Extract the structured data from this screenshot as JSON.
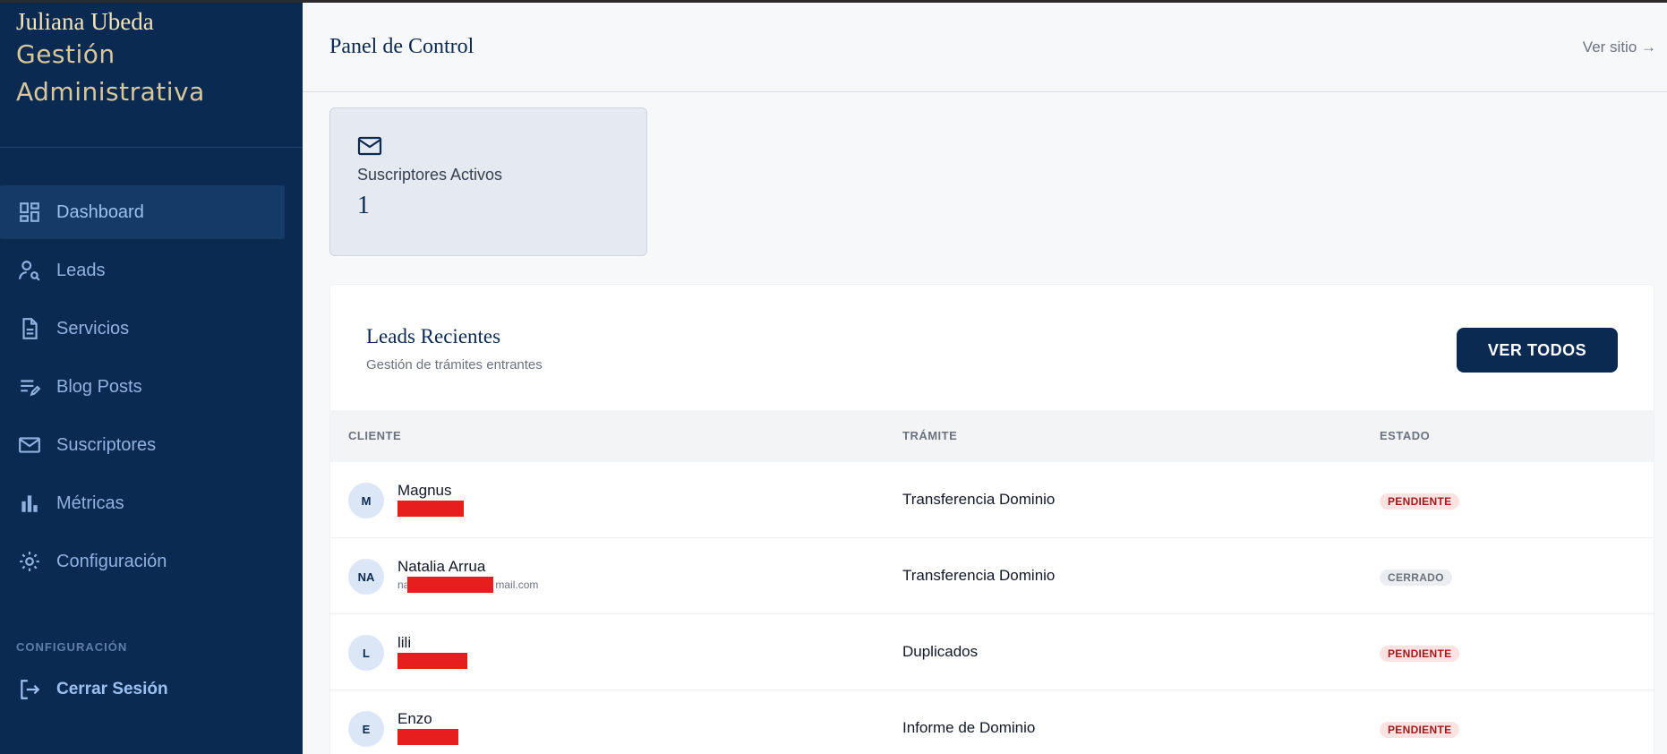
{
  "brand": {
    "name": "Juliana Ubeda",
    "subtitle_line1": "Gestión",
    "subtitle_line2": "Administrativa"
  },
  "sidebar": {
    "items": [
      {
        "label": "Dashboard",
        "icon": "dashboard-icon",
        "active": true
      },
      {
        "label": "Leads",
        "icon": "user-search-icon"
      },
      {
        "label": "Servicios",
        "icon": "document-icon"
      },
      {
        "label": "Blog Posts",
        "icon": "edit-list-icon"
      },
      {
        "label": "Suscriptores",
        "icon": "mail-icon"
      },
      {
        "label": "Métricas",
        "icon": "bar-chart-icon"
      },
      {
        "label": "Configuración",
        "icon": "gear-icon"
      }
    ],
    "section_label": "CONFIGURACIÓN",
    "logout_label": "Cerrar Sesión"
  },
  "header": {
    "title": "Panel de Control",
    "link": "Ver sitio →"
  },
  "stat": {
    "label": "Suscriptores Activos",
    "value": "1",
    "icon": "mail-icon"
  },
  "leads": {
    "title": "Leads Recientes",
    "subtitle": "Gestión de trámites entrantes",
    "button": "VER TODOS",
    "columns": [
      "CLIENTE",
      "TRÁMITE",
      "ESTADO"
    ],
    "rows": [
      {
        "initials": "M",
        "name": "Magnus",
        "email": "",
        "tramite": "Transferencia Dominio",
        "estado": "PENDIENTE"
      },
      {
        "initials": "NA",
        "name": "Natalia Arrua",
        "email_prefix": "na",
        "email_suffix": "mail.com",
        "tramite": "Transferencia Dominio",
        "estado": "CERRADO"
      },
      {
        "initials": "L",
        "name": "lili",
        "email": "",
        "tramite": "Duplicados",
        "estado": "PENDIENTE"
      },
      {
        "initials": "E",
        "name": "Enzo",
        "email": "",
        "tramite": "Informe de Dominio",
        "estado": "PENDIENTE"
      }
    ]
  },
  "colors": {
    "sidebar_bg": "#0b2a52",
    "accent": "#0b2a52",
    "pending_bg": "#fde2e2",
    "pending_text": "#a21a1a"
  }
}
